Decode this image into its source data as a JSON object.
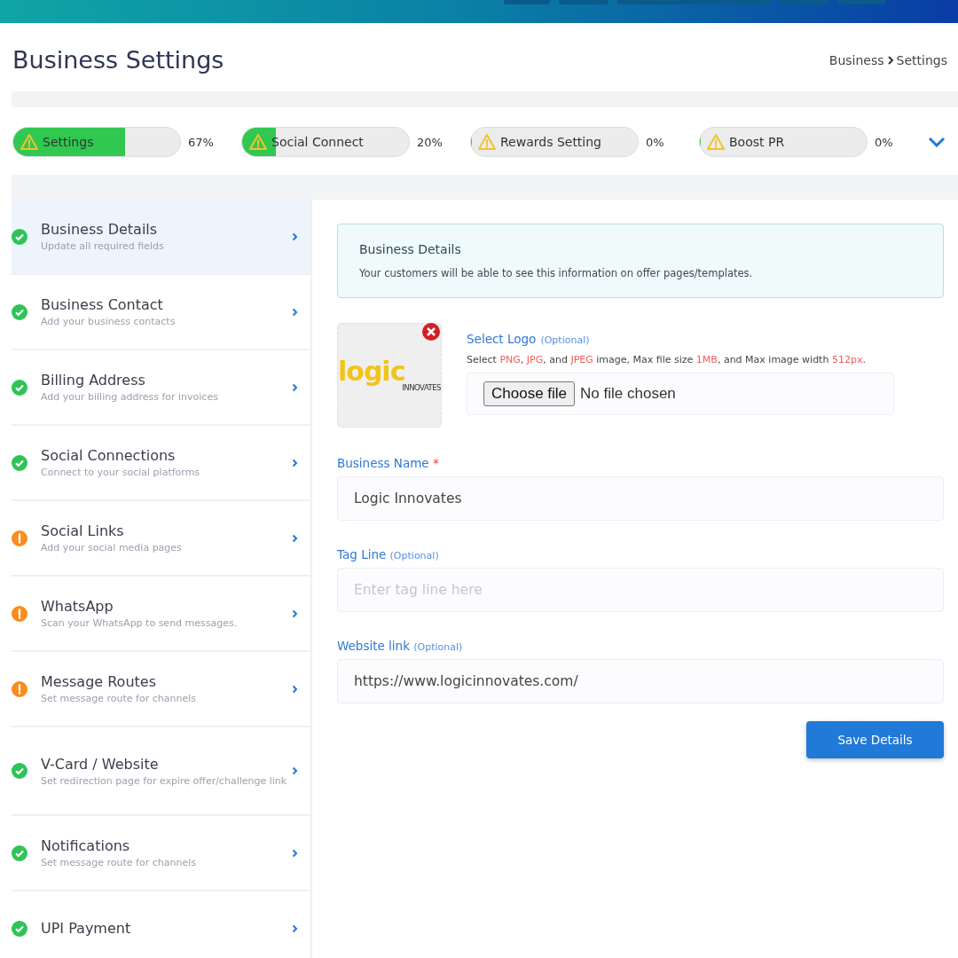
{
  "page": {
    "title": "Business Settings",
    "breadcrumb": [
      "Business",
      "Settings"
    ]
  },
  "progress": [
    {
      "label": "Settings",
      "level": 0.67,
      "percent": "67%"
    },
    {
      "label": "Social Connect",
      "level": 0.2,
      "percent": "20%"
    },
    {
      "label": "Rewards Setting",
      "level": 0,
      "percent": "0%"
    },
    {
      "label": "Boost PR",
      "level": 0,
      "percent": "0%"
    }
  ],
  "sidebar": {
    "items": [
      {
        "title": "Business Details",
        "subtitle": "Update all required fields",
        "kind": "done",
        "selected": true
      },
      {
        "title": "Business Contact",
        "subtitle": "Add your business contacts",
        "kind": "done",
        "selected": false
      },
      {
        "title": "Billing Address",
        "subtitle": "Add your billing address for invoices",
        "kind": "done",
        "selected": false
      },
      {
        "title": "Social Connections",
        "subtitle": "Connect to your social platforms",
        "kind": "done",
        "selected": false
      },
      {
        "title": "Social Links",
        "subtitle": "Add your social media pages",
        "kind": "pending",
        "selected": false
      },
      {
        "title": "WhatsApp",
        "subtitle": "Scan your WhatsApp to send messages.",
        "kind": "pending",
        "selected": false
      },
      {
        "title": "Message Routes",
        "subtitle": "Set message route for channels",
        "kind": "pending",
        "selected": false
      },
      {
        "title": "V-Card / Website",
        "subtitle": "Set redirection page for expire offer/challenge link",
        "kind": "done",
        "selected": false
      },
      {
        "title": "Notifications",
        "subtitle": "Set message route for channels",
        "kind": "done",
        "selected": false
      },
      {
        "title": "UPI Payment",
        "kind": "done",
        "selected": false
      }
    ]
  },
  "info": {
    "title": "Business Details",
    "text": "Your customers will be able to see this information on offer pages/templates."
  },
  "logo": {
    "preview_word": "logic",
    "preview_tag": "INNOVATES",
    "label": "Select Logo",
    "note": "(Optional)",
    "hint": "Select **PNG**, **JPG**, and **JPEG** image, Max file size **1MB**, and Max image width **512px**.",
    "file_button": "Choose file",
    "file_status": "No file chosen"
  },
  "fields": [
    {
      "label": "Business Name",
      "required_mark": "*",
      "value": "Logic Innovates"
    },
    {
      "label": "Tag Line",
      "note": "(Optional)",
      "placeholder": "Enter tag line here"
    },
    {
      "label": "Website link",
      "note": "(Optional)",
      "value": "https://www.logicinnovates.com/"
    }
  ],
  "save_button": "Save Details"
}
